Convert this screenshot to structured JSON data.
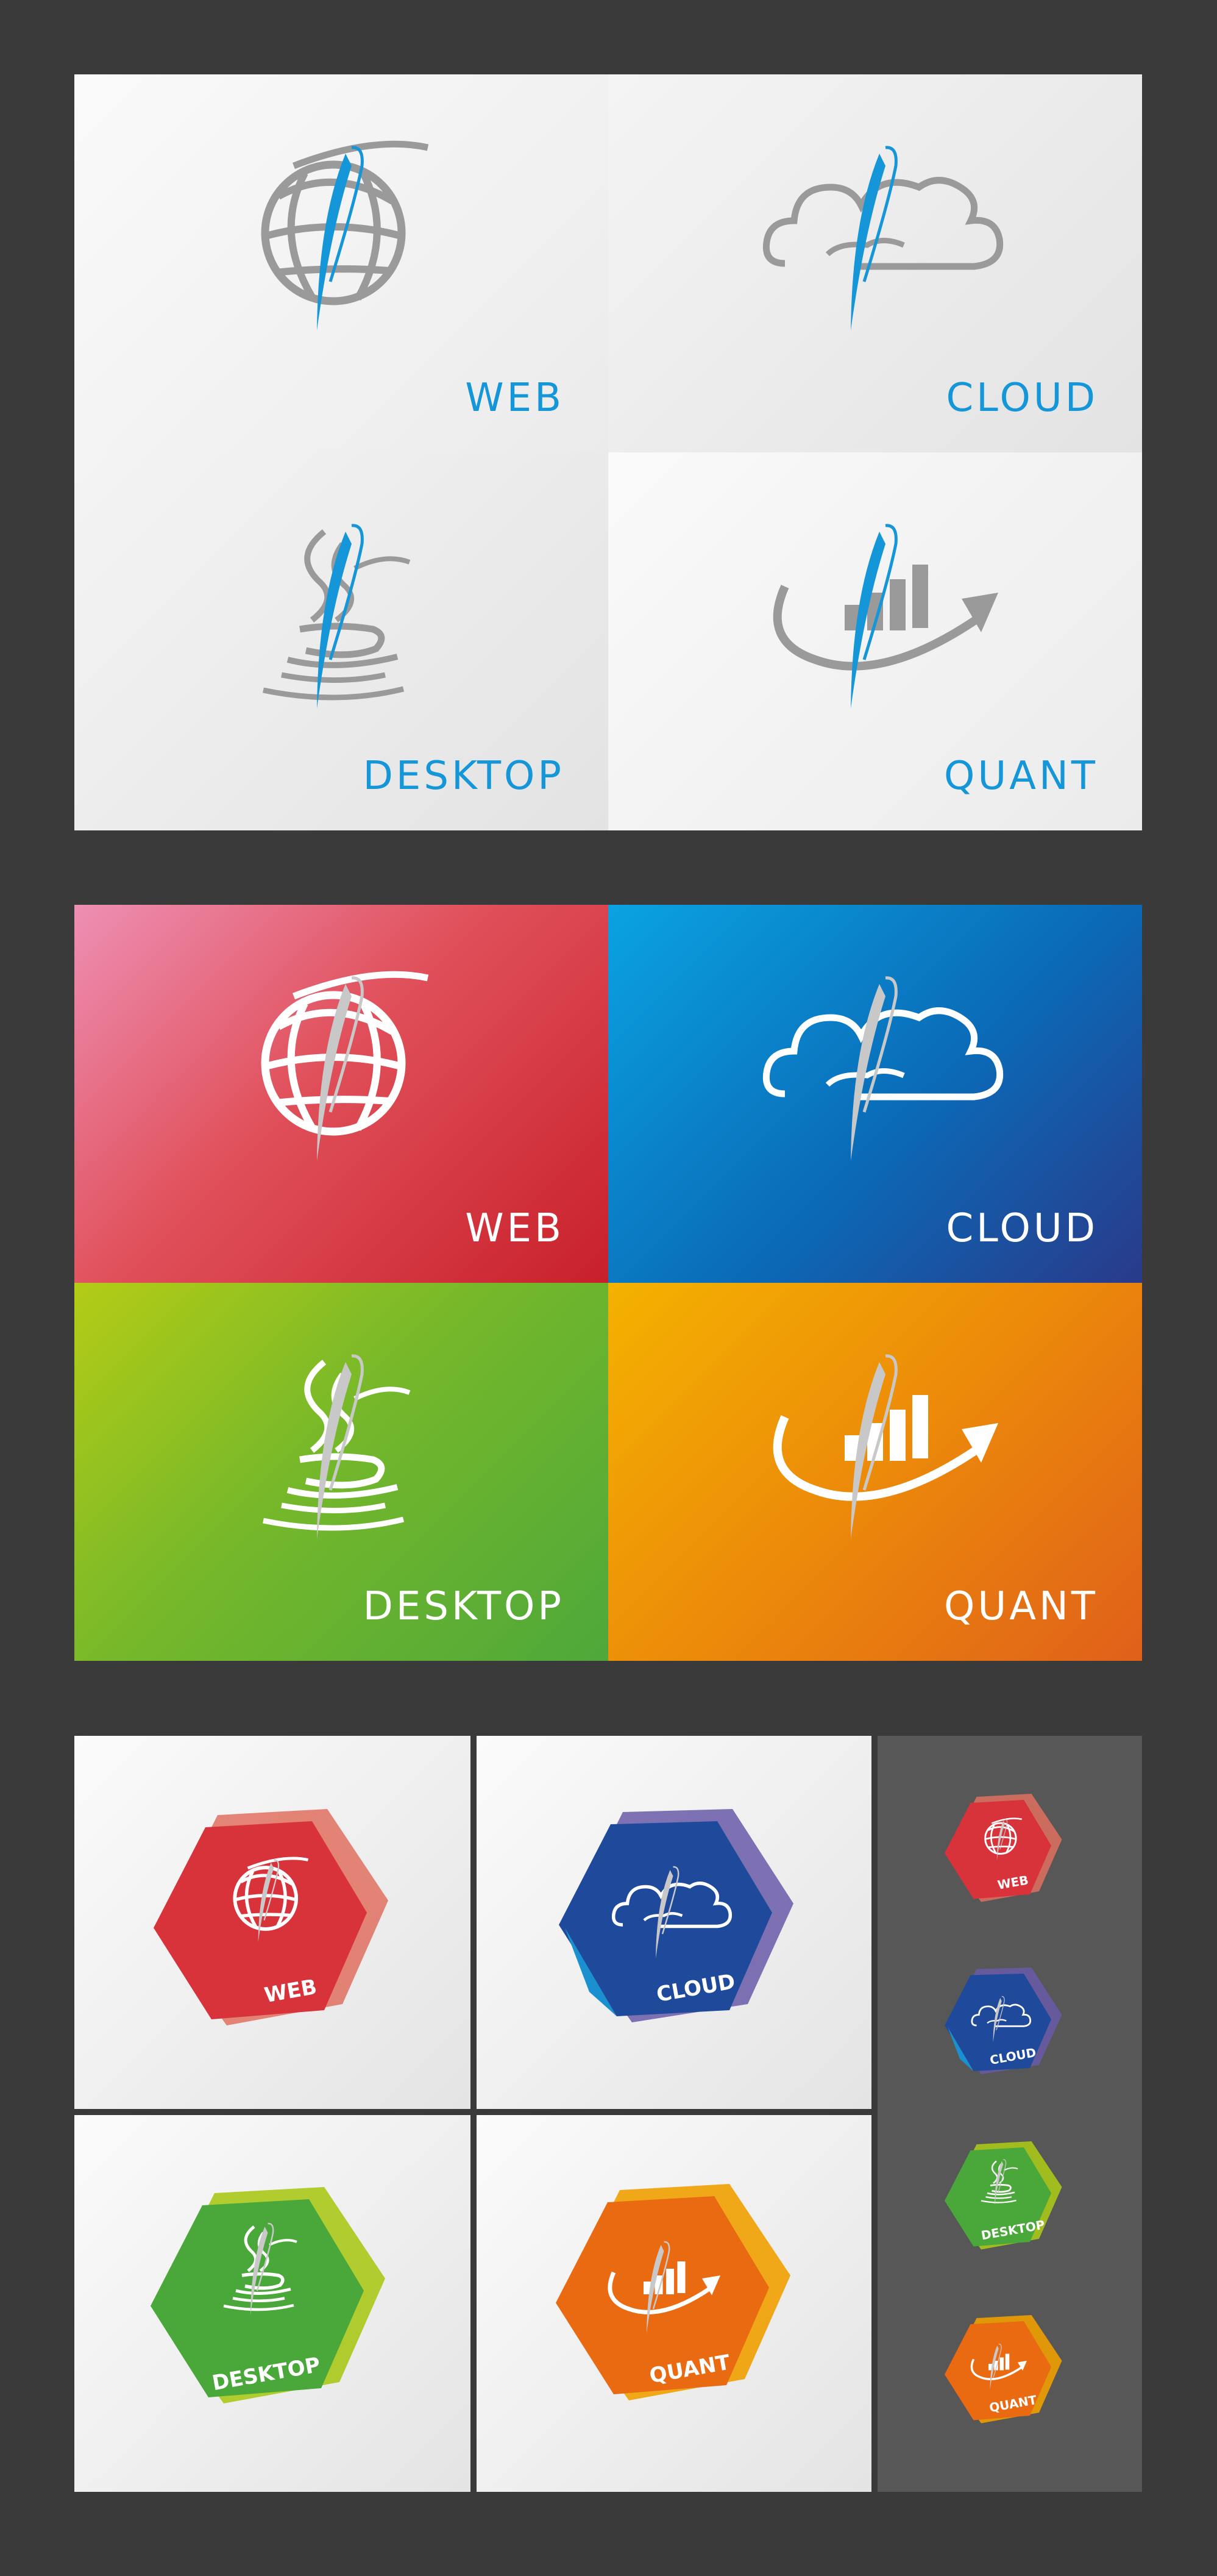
{
  "sections": {
    "light": {
      "tiles": [
        {
          "label": "WEB"
        },
        {
          "label": "CLOUD"
        },
        {
          "label": "DESKTOP"
        },
        {
          "label": "QUANT"
        }
      ]
    },
    "color": {
      "tiles": [
        {
          "label": "WEB"
        },
        {
          "label": "CLOUD"
        },
        {
          "label": "DESKTOP"
        },
        {
          "label": "QUANT"
        }
      ]
    },
    "hex": {
      "badges": [
        {
          "label": "WEB"
        },
        {
          "label": "CLOUD"
        },
        {
          "label": "DESKTOP"
        },
        {
          "label": "QUANT"
        }
      ],
      "small_badges": [
        {
          "label": "WEB"
        },
        {
          "label": "CLOUD"
        },
        {
          "label": "DESKTOP"
        },
        {
          "label": "QUANT"
        }
      ]
    }
  },
  "colors": {
    "background": "#3a3a3a",
    "accent_blue": "#1596d8",
    "icon_gray": "#9a9a9a",
    "web": "#d8333b",
    "cloud": "#1f4a9c",
    "desktop": "#5aac2c",
    "quant": "#ea6a12",
    "side_panel": "#575757"
  },
  "icons": [
    "globe-icon",
    "cloud-icon",
    "coffee-cup-icon",
    "growth-chart-icon",
    "quill-icon"
  ]
}
